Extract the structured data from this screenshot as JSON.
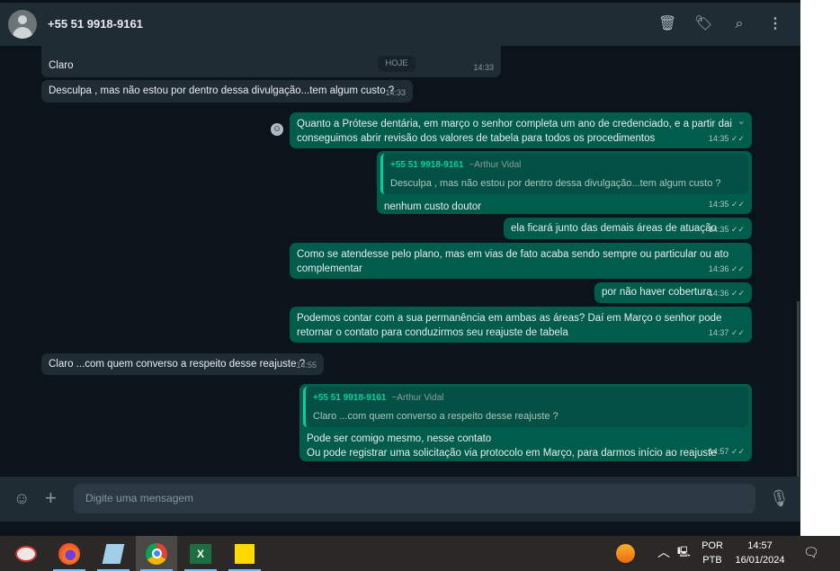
{
  "header": {
    "contact": "+55 51 9918-9161",
    "icons": [
      "delete-icon",
      "label-icon",
      "search-icon",
      "menu-icon"
    ]
  },
  "chat": {
    "date_badge": "HOJE",
    "messages": [
      {
        "dir": "in",
        "text": "Claro",
        "time": "14:33"
      },
      {
        "dir": "in",
        "text": "Desculpa , mas não estou por dentro dessa divulgação...tem algum custo ?",
        "time": "14:33"
      },
      {
        "dir": "out",
        "text": "Quanto a Prótese dentária, em março o senhor completa um ano de credenciado, e a partir dai conseguimos abrir revisão dos valores de tabela para todos os procedimentos",
        "time": "14:35"
      },
      {
        "dir": "out",
        "quote": {
          "name": "+55 51 9918-9161",
          "author": "~Arthur Vidal",
          "text": "Desculpa , mas não estou por dentro dessa divulgação...tem algum custo ?"
        },
        "text": "nenhum custo doutor",
        "time": "14:35"
      },
      {
        "dir": "out",
        "text": "ela ficará junto das demais áreas de atuação",
        "time": "14:35"
      },
      {
        "dir": "out",
        "text": "Como se atendesse pelo plano, mas em vias de fato acaba sendo sempre ou particular ou ato complementar",
        "time": "14:36"
      },
      {
        "dir": "out",
        "text": "por não haver cobertura",
        "time": "14:36"
      },
      {
        "dir": "out",
        "text": "Podemos contar com a sua permanência em ambas as áreas? Daí em Março o senhor pode retornar o contato para conduzirmos seu reajuste de tabela",
        "time": "14:37"
      },
      {
        "dir": "in",
        "text": "Claro ...com quem converso a respeito desse reajuste ?",
        "time": "14:55"
      },
      {
        "dir": "out",
        "quote": {
          "name": "+55 51 9918-9161",
          "author": "~Arthur Vidal",
          "text": "Claro ...com quem converso a respeito desse reajuste ?"
        },
        "text": "Pode ser comigo mesmo, nesse contato",
        "text2": "Ou pode registrar uma solicitação via protocolo em Março, para darmos início ao reajuste",
        "time": "14:57"
      }
    ]
  },
  "footer": {
    "placeholder": "Digite uma mensagem"
  },
  "taskbar": {
    "lang1": "POR",
    "lang2": "PTB",
    "time": "14:57",
    "date": "16/01/2024"
  }
}
